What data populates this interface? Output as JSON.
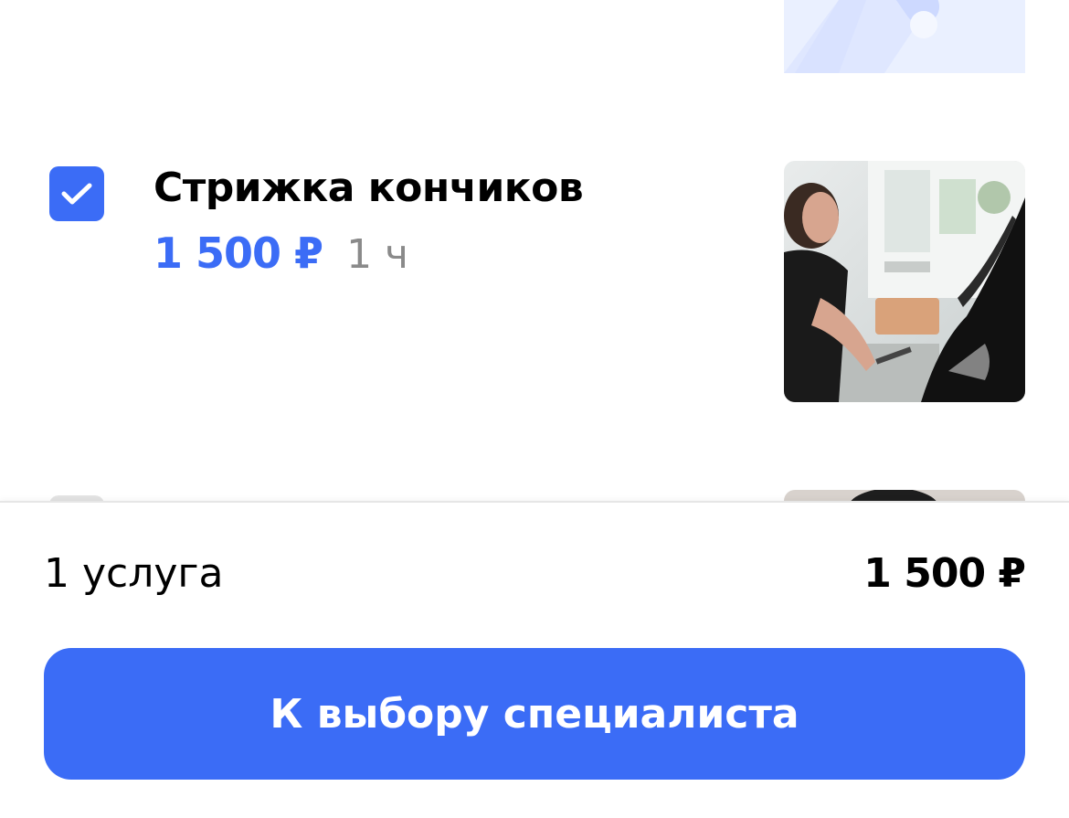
{
  "services": {
    "selected": {
      "title": "Стрижка кончиков",
      "price": "1 500 ₽",
      "duration": "1 ч",
      "checked": true
    },
    "next": {
      "checked": false
    }
  },
  "summary": {
    "count": "1 услуга",
    "total": "1 500 ₽"
  },
  "cta": {
    "label": "К выбору специалиста"
  },
  "colors": {
    "accent": "#3b6cf6",
    "muted_text": "#8a8a8a",
    "unchecked_box": "#e3e3e3"
  },
  "icons": {
    "checkbox_checked": "check-icon"
  }
}
